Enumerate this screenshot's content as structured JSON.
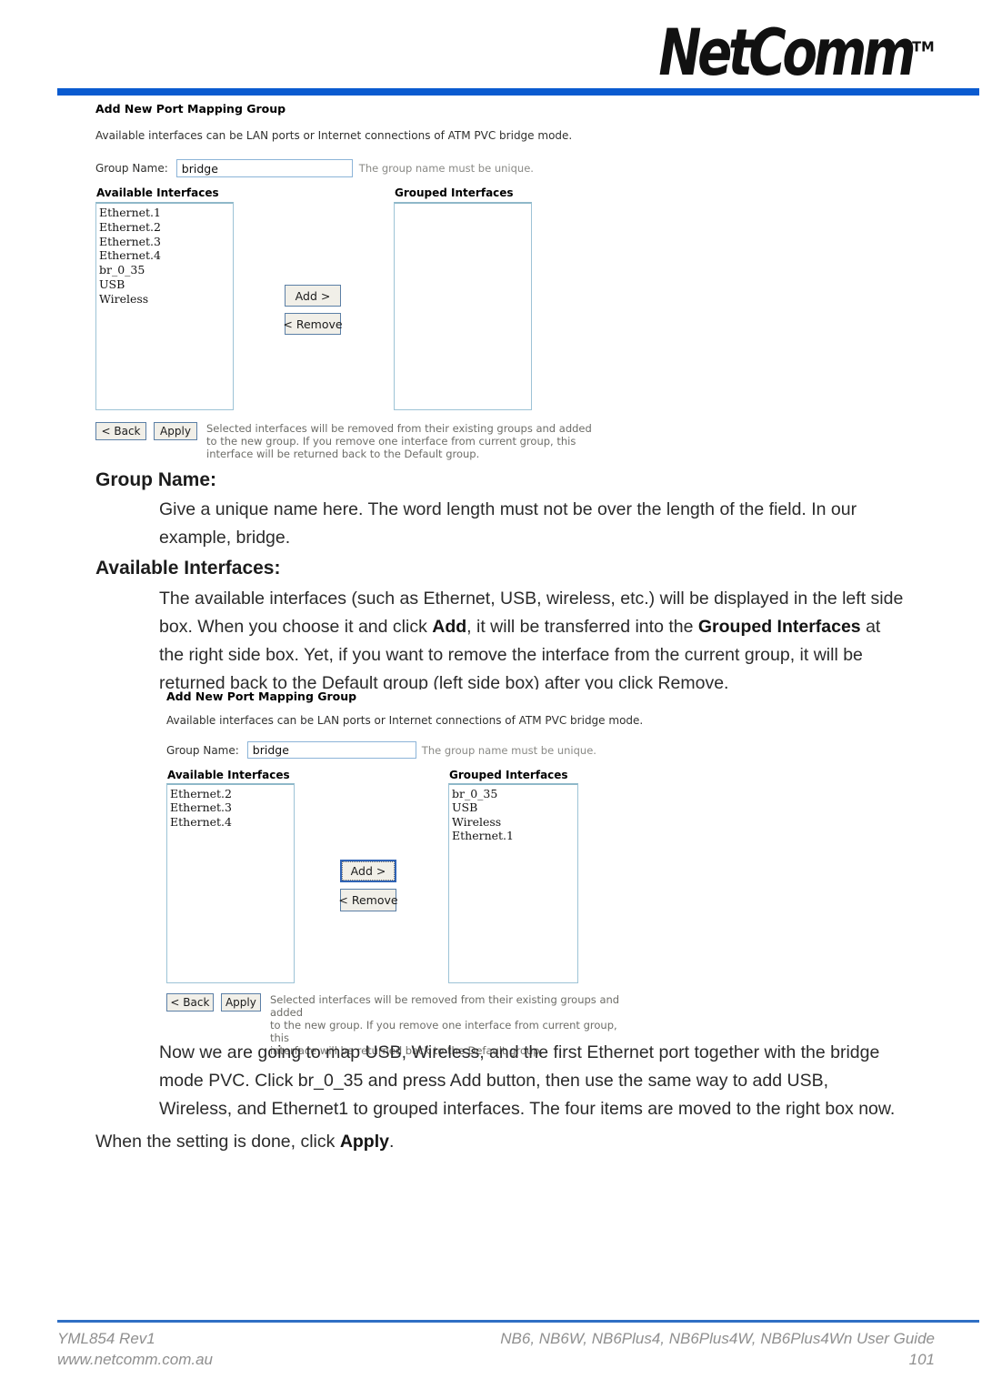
{
  "header": {
    "brand": "NetComm",
    "brand_tm": "TM"
  },
  "screenshot1": {
    "title": "Add New Port Mapping Group",
    "description": "Available interfaces can be LAN ports or Internet connections of ATM PVC bridge mode.",
    "group_name_label": "Group Name:",
    "group_name_value": "bridge",
    "group_name_hint": "The group name must be unique.",
    "available_header": "Available Interfaces",
    "grouped_header": "Grouped Interfaces",
    "available_items": [
      "Ethernet.1",
      "Ethernet.2",
      "Ethernet.3",
      "Ethernet.4",
      "br_0_35",
      "USB",
      "Wireless"
    ],
    "grouped_items": [],
    "add_button": "Add >",
    "remove_button": "< Remove",
    "back_button": "< Back",
    "apply_button": "Apply",
    "footer_note": "Selected interfaces will be removed from their existing groups and added\nto the new group. If you remove one interface from current group, this\ninterface will be returned back to the Default group."
  },
  "screenshot2": {
    "title": "Add New Port Mapping Group",
    "description": "Available interfaces can be LAN ports or Internet connections of ATM PVC bridge mode.",
    "group_name_label": "Group Name:",
    "group_name_value": "bridge",
    "group_name_hint": "The group name must be unique.",
    "available_header": "Available Interfaces",
    "grouped_header": "Grouped Interfaces",
    "available_items": [
      "Ethernet.2",
      "Ethernet.3",
      "Ethernet.4"
    ],
    "grouped_items": [
      "br_0_35",
      "USB",
      "Wireless",
      "Ethernet.1"
    ],
    "add_button": "Add >",
    "remove_button": "< Remove",
    "back_button": "< Back",
    "apply_button": "Apply",
    "footer_note": "Selected interfaces will be removed from their existing groups and added\nto the new group. If you remove one interface from current group, this\ninterface will be returned back to the Default group."
  },
  "body": {
    "heading_group_name": "Group Name:",
    "para_group_name": "Give a unique name here. The word length must not be over the length of the field. In our example, bridge.",
    "heading_available_interfaces": "Available Interfaces:",
    "para_available_interfaces_1": "The available interfaces (such as Ethernet, USB, wireless, etc.) will be displayed in the left side box. When you choose it and click ",
    "para_available_interfaces_bold_add": "Add",
    "para_available_interfaces_2": ", it will be transferred into the ",
    "para_available_interfaces_bold_grouped": "Grouped Interfaces",
    "para_available_interfaces_3": " at the right side box. Yet, if you want to remove the interface from the current group, it will be returned back to the Default group (left side box) after you click Remove.",
    "para_mapping": "Now we are going to map USB, Wireless, and the first Ethernet port together with the bridge mode PVC. Click br_0_35 and press Add button, then use the same way to add USB, Wireless, and Ethernet1 to grouped interfaces. The four items are moved to the right box now.",
    "para_apply_1": "When the setting is done, click ",
    "para_apply_bold": "Apply",
    "para_apply_2": "."
  },
  "footer": {
    "doc_id": "YML854 Rev1",
    "website": "www.netcomm.com.au",
    "guide_title": "NB6, NB6W, NB6Plus4, NB6Plus4W, NB6Plus4Wn User Guide",
    "page_number": "101"
  },
  "colors": {
    "brand_blue": "#0a5bd0",
    "footer_blue": "#2f6fc4"
  }
}
